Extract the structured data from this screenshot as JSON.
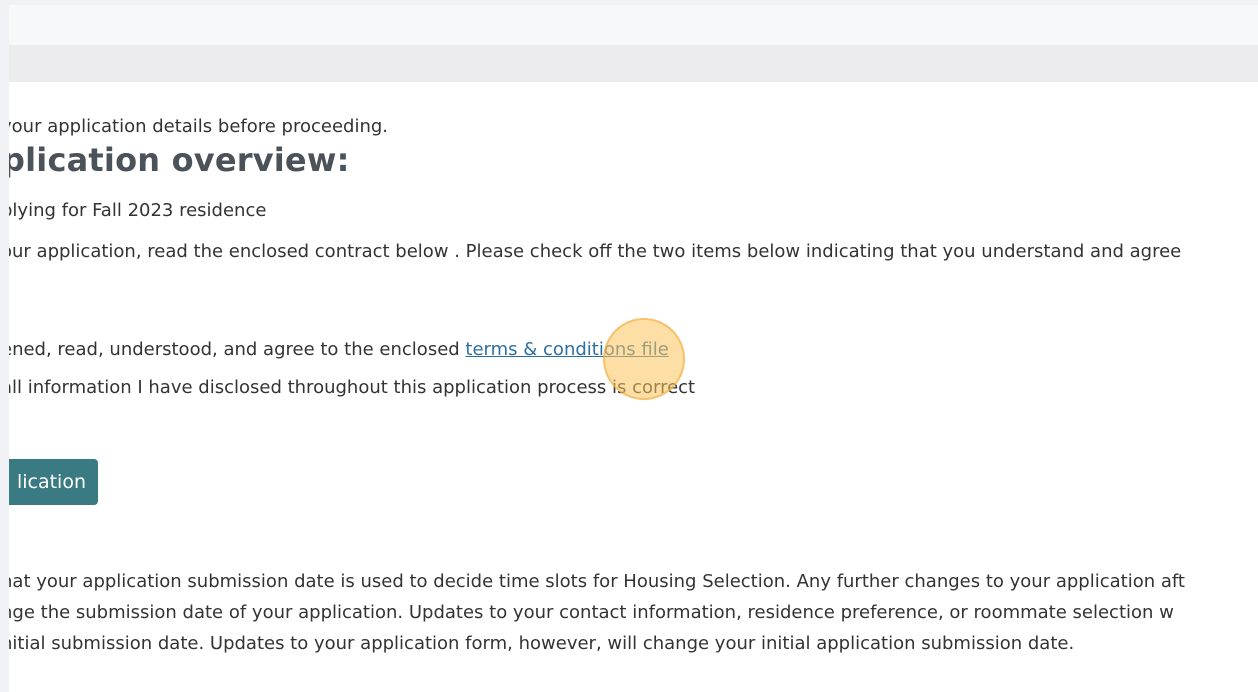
{
  "intro_text": "your application details before proceeding.",
  "overview_heading": "plication overview:",
  "term_text": "plying for Fall 2023 residence",
  "instruction_text": "our application, read the enclosed contract below . Please check off the two items below indicating that you understand and agree",
  "agreements": {
    "terms_prefix": "ened, read, understood, and agree to the enclosed ",
    "terms_link": "terms & conditions file",
    "info_text": "all information I have disclosed throughout this application process is correct"
  },
  "submit_label": "lication",
  "note_lines": [
    "hat your application submission date is used to decide time slots for Housing Selection. Any further changes to your application aft",
    "nge the submission date of your application. Updates to your contact information, residence preference, or roommate selection w",
    "nitial submission date. Updates to your application form, however, will change your initial application submission date."
  ],
  "colors": {
    "button": "#3a7a83",
    "link": "#2d6fa3",
    "click_indicator": "#fcc45c"
  }
}
